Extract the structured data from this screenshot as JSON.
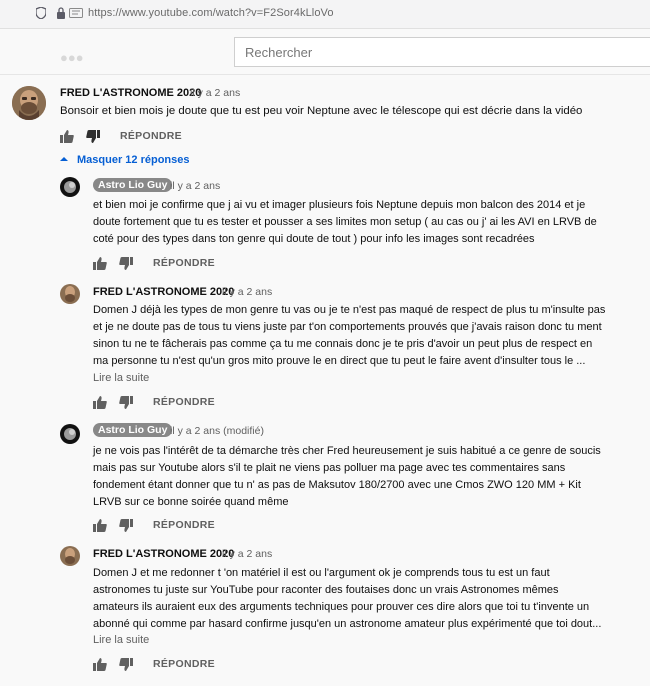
{
  "browser": {
    "url": "https://www.youtube.com/watch?v=F2Sor4kLloVo"
  },
  "header": {
    "search_placeholder": "Rechercher"
  },
  "top_comment": {
    "author": "FRED L'ASTRONOME 2020",
    "date": "il y a 2 ans",
    "text": "Bonsoir et bien mois je doute que tu est peu voir Neptune avec le télescope qui est décrie dans la vidéo",
    "reply_label": "RÉPONDRE",
    "toggle_label": "Masquer 12 réponses"
  },
  "replies": [
    {
      "author": "Astro Lio Guy",
      "date": "il y a 2 ans",
      "lines": [
        "et bien moi je confirme que j ai vu et imager plusieurs fois Neptune depuis mon balcon des 2014 et je",
        "doute fortement que tu es tester et pousser a ses limites mon setup  ( au cas ou j' ai les AVI en LRVB de",
        "coté pour des types dans ton genre qui doute de tout ) pour info les images sont recadrées"
      ],
      "reply_label": "RÉPONDRE"
    },
    {
      "author": "FRED L'ASTRONOME 2020",
      "date": "il y a 2 ans",
      "lines": [
        "Domen J  déjà les types de mon genre tu vas ou je te n'est pas maqué de respect de plus tu m'insulte pas",
        "et je ne doute pas de tous tu viens juste par t'on comportements prouvés que j'avais raison donc tu ment",
        "sinon tu ne te fâcherais pas comme ça tu me connais donc je te pris d'avoir un peut plus de respect en",
        "ma personne tu n'est qu'un gros mito prouve le en direct que tu peut le faire avent d'insulter tous le ..."
      ],
      "more_label": "Lire la suite",
      "reply_label": "RÉPONDRE"
    },
    {
      "author": "Astro Lio Guy",
      "date": "il y a 2 ans (modifié)",
      "lines": [
        "je ne vois pas l'intérêt de ta démarche très cher Fred heureusement je suis habitué a ce genre de soucis",
        "mais pas sur Youtube  alors s'il te plait ne viens pas polluer ma page avec tes commentaires sans",
        "fondement étant donner que tu n' as pas de Maksutov 180/2700 avec une Cmos ZWO 120 MM + Kit",
        "LRVB  sur ce bonne soirée quand même"
      ],
      "reply_label": "RÉPONDRE"
    },
    {
      "author": "FRED L'ASTRONOME 2020",
      "date": "il y a 2 ans",
      "lines": [
        "Domen J et me redonner t 'on matériel il est ou l'argument ok je comprends tous tu est un faut",
        "astronomes tu juste sur YouTube pour raconter des foutaises donc un vrais Astronomes mêmes",
        "amateurs ils auraient eux des arguments techniques pour prouver ces dire alors que toi tu t'invente un",
        "abonné qui comme par hasard confirme jusqu'en un astronome amateur plus expérimenté que toi dout..."
      ],
      "more_label": "Lire la suite",
      "reply_label": "RÉPONDRE"
    }
  ]
}
